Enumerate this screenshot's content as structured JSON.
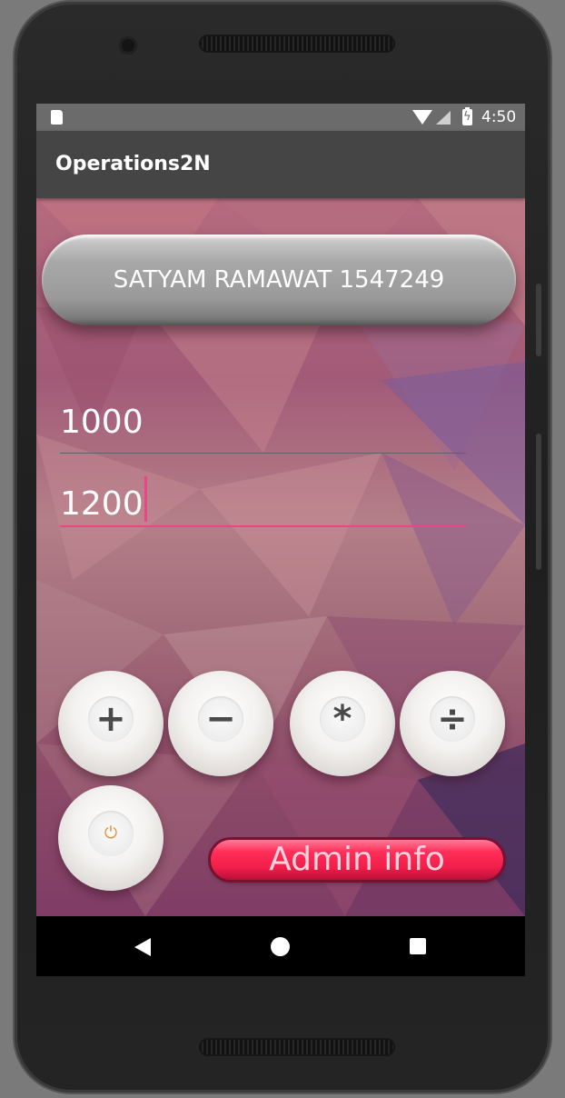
{
  "statusbar": {
    "time": "4:50",
    "icons": [
      "sd-card-icon",
      "wifi-icon",
      "cell-signal-icon",
      "battery-charging-icon"
    ]
  },
  "appbar": {
    "title": "Operations2N"
  },
  "main": {
    "name_button": "SATYAM RAMAWAT 1547249",
    "input1": {
      "value": "1000"
    },
    "input2": {
      "value": "1200",
      "focused": true
    },
    "operators": [
      {
        "label": "+",
        "icon": "plus-icon"
      },
      {
        "label": "−",
        "icon": "minus-icon"
      },
      {
        "label": "*",
        "icon": "multiply-icon"
      },
      {
        "label": "÷",
        "icon": "divide-icon"
      }
    ],
    "power": {
      "label": "⏻",
      "icon": "power-icon"
    },
    "admin_button": "Admin info"
  },
  "navbar": {
    "icons": [
      "back-icon",
      "home-icon",
      "recents-icon"
    ]
  },
  "colors": {
    "accent": "#e84686",
    "appbar": "#454545",
    "statusbar": "#6b6b6b",
    "admin_button": "#ff2f5a"
  }
}
